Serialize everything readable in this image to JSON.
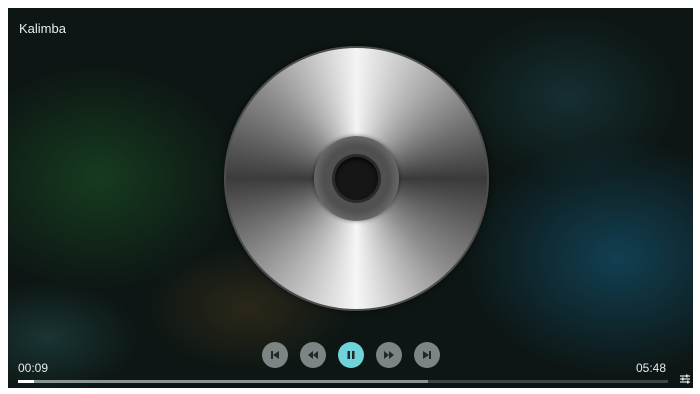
{
  "track": {
    "title": "Kalimba"
  },
  "playback": {
    "elapsed": "00:09",
    "duration": "05:48",
    "progress_fraction": 0.025,
    "buffered_fraction": 0.63,
    "state": "playing"
  },
  "controls": [
    {
      "name": "skip-previous-button",
      "icon": "skip-previous-icon"
    },
    {
      "name": "rewind-button",
      "icon": "rewind-icon"
    },
    {
      "name": "pause-button",
      "icon": "pause-icon"
    },
    {
      "name": "fast-forward-button",
      "icon": "fast-forward-icon"
    },
    {
      "name": "skip-next-button",
      "icon": "skip-next-icon"
    }
  ],
  "settings_icon": "equalizer-icon",
  "colors": {
    "accent": "#6fd3d9",
    "control_bg": "#7c8484",
    "text": "#e6eaea"
  }
}
